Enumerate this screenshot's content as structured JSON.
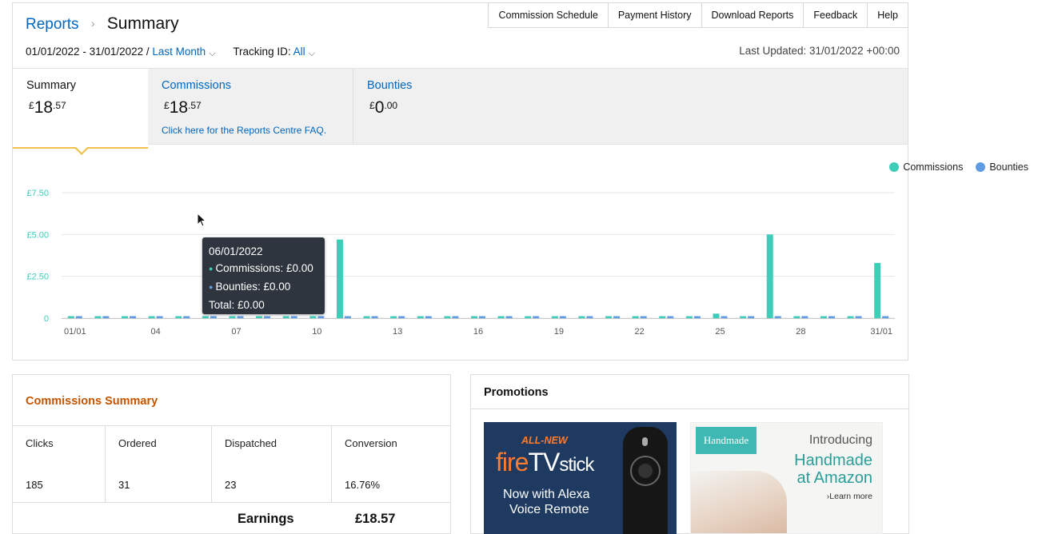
{
  "breadcrumb": {
    "root": "Reports",
    "separator": "›",
    "current": "Summary"
  },
  "topnav": [
    "Commission Schedule",
    "Payment History",
    "Download Reports",
    "Feedback",
    "Help"
  ],
  "date_filter": {
    "range": "01/01/2022 - 31/01/2022 /",
    "preset": "Last Month",
    "tracking_label": "Tracking ID:",
    "tracking_value": "All"
  },
  "last_updated": "Last Updated: 31/01/2022 +00:00",
  "tabs": {
    "summary": {
      "label": "Summary",
      "currency": "£",
      "pounds": "18",
      "pence": ".57"
    },
    "commissions": {
      "label": "Commissions",
      "currency": "£",
      "pounds": "18",
      "pence": ".57",
      "faq": "Click here for the Reports Centre FAQ."
    },
    "bounties": {
      "label": "Bounties",
      "currency": "£",
      "pounds": "0",
      "pence": ".00"
    }
  },
  "legend": [
    {
      "label": "Commissions",
      "color": "#3ecdb8"
    },
    {
      "label": "Bounties",
      "color": "#5f9be3"
    }
  ],
  "chart_data": {
    "type": "bar",
    "y_tick_labels": [
      "0",
      "£2.50",
      "£5.00",
      "£7.50"
    ],
    "y_ticks": [
      0,
      2.5,
      5,
      7.5
    ],
    "ylim": [
      0,
      7.5
    ],
    "x_tick_labels": [
      "01/01",
      "04",
      "07",
      "10",
      "13",
      "16",
      "19",
      "22",
      "25",
      "28",
      "31/01"
    ],
    "x_tick_days": [
      1,
      4,
      7,
      10,
      13,
      16,
      19,
      22,
      25,
      28,
      31
    ],
    "days": [
      1,
      2,
      3,
      4,
      5,
      6,
      7,
      8,
      9,
      10,
      11,
      12,
      13,
      14,
      15,
      16,
      17,
      18,
      19,
      20,
      21,
      22,
      23,
      24,
      25,
      26,
      27,
      28,
      29,
      30,
      31
    ],
    "series": [
      {
        "name": "Commissions",
        "color": "#3ecdb8",
        "values": [
          0,
          0,
          0,
          0,
          0,
          0,
          0,
          0,
          0,
          0,
          4.7,
          0,
          0,
          0,
          0,
          0,
          0,
          0,
          0,
          0,
          0,
          0,
          0,
          0,
          0.27,
          0,
          5.0,
          0,
          0,
          0,
          3.3
        ]
      },
      {
        "name": "Bounties",
        "color": "#5f9be3",
        "values": [
          0,
          0,
          0,
          0,
          0,
          0,
          0,
          0,
          0,
          0,
          0,
          0,
          0,
          0,
          0,
          0,
          0,
          0,
          0,
          0,
          0,
          0,
          0,
          0,
          0,
          0,
          0,
          0,
          0,
          0,
          0
        ]
      }
    ]
  },
  "tooltip": {
    "date": "06/01/2022",
    "commissions": "Commissions: £0.00",
    "bounties": "Bounties: £0.00",
    "total": "Total: £0.00"
  },
  "commissions_summary": {
    "title": "Commissions Summary",
    "stats": [
      {
        "label": "Clicks",
        "value": "185"
      },
      {
        "label": "Ordered",
        "value": "31"
      },
      {
        "label": "Dispatched",
        "value": "23"
      },
      {
        "label": "Conversion",
        "value": "16.76%"
      }
    ],
    "earnings_label": "Earnings",
    "earnings_value": "£18.57"
  },
  "promotions": {
    "title": "Promotions",
    "fire": {
      "line1": "ALL-NEW",
      "line2a": "fire",
      "line2b": "TV",
      "line2c": "stick",
      "line3": "Now with Alexa",
      "line4": "Voice Remote"
    },
    "handmade": {
      "badge": "Handmade",
      "line1": "Introducing",
      "line2": "Handmade",
      "line3": "at Amazon",
      "link": "›Learn more"
    }
  }
}
